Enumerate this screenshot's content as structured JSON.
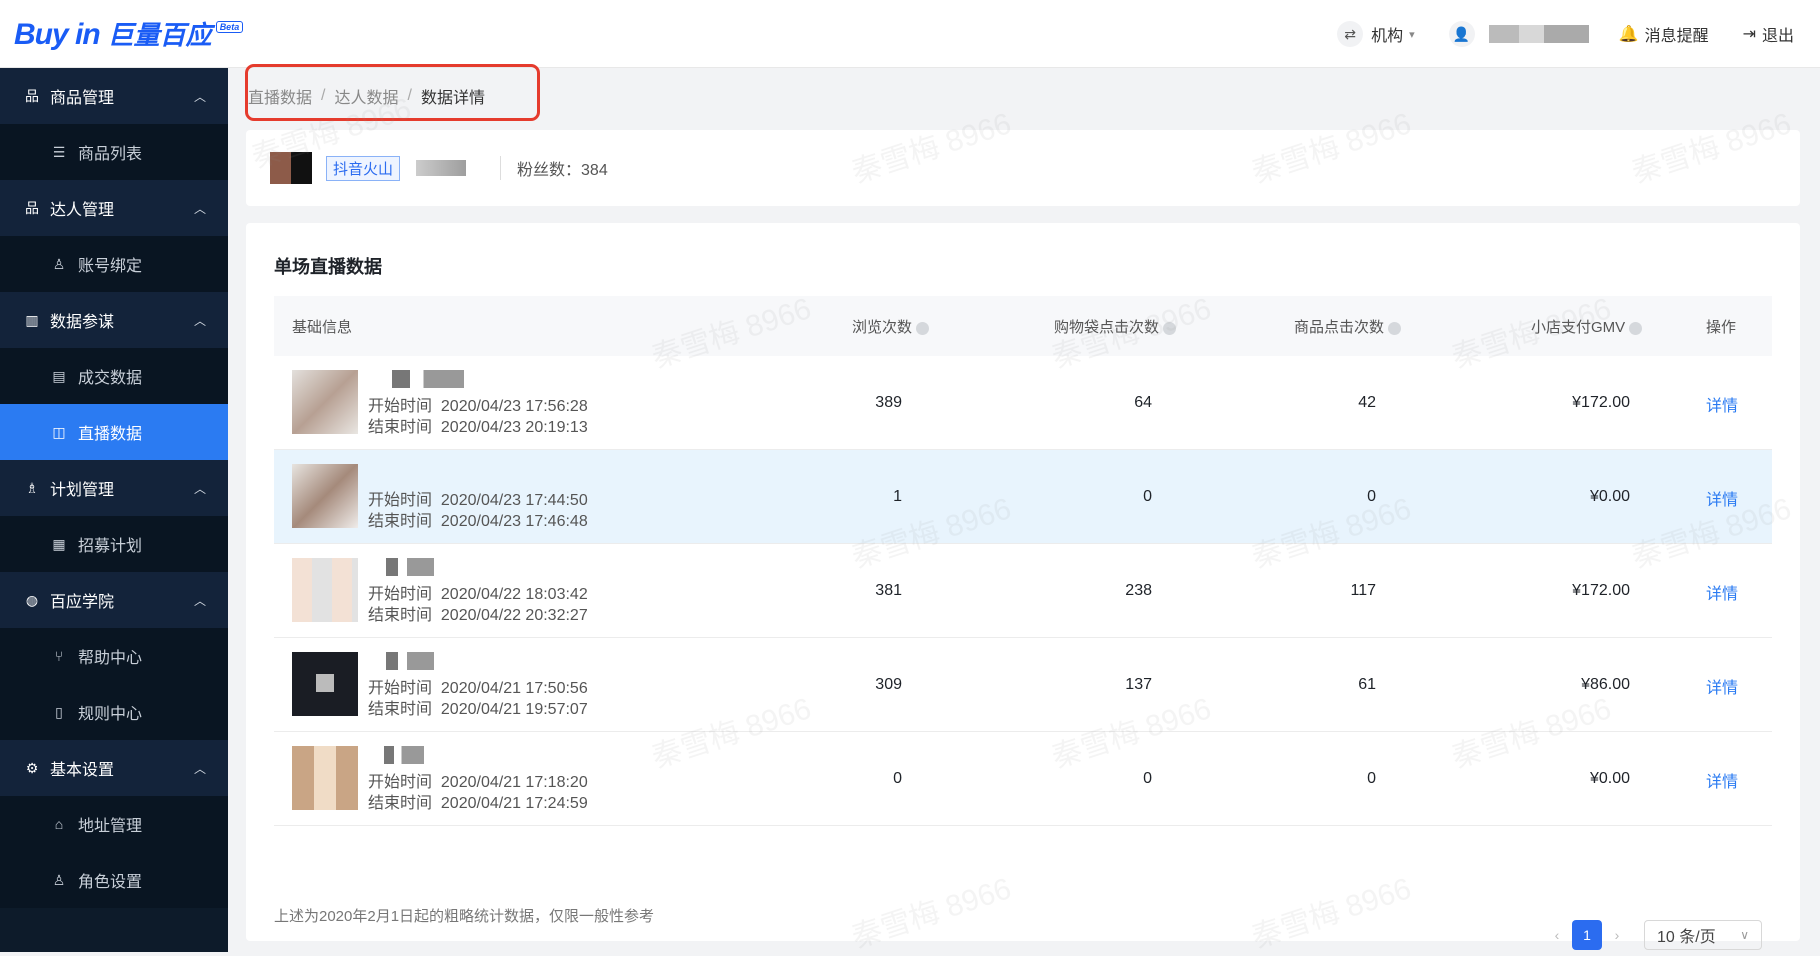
{
  "header": {
    "logo_en": "Buy in",
    "logo_cn": "巨量百应",
    "logo_beta": "Beta",
    "org_label": "机构",
    "notify_label": "消息提醒",
    "logout_label": "退出"
  },
  "sidebar": {
    "groups": [
      {
        "label": "商品管理",
        "items": [
          {
            "label": "商品列表"
          }
        ]
      },
      {
        "label": "达人管理",
        "items": [
          {
            "label": "账号绑定"
          }
        ]
      },
      {
        "label": "数据参谋",
        "items": [
          {
            "label": "成交数据"
          },
          {
            "label": "直播数据"
          }
        ]
      },
      {
        "label": "计划管理",
        "items": [
          {
            "label": "招募计划"
          }
        ]
      },
      {
        "label": "百应学院",
        "items": [
          {
            "label": "帮助中心"
          },
          {
            "label": "规则中心"
          }
        ]
      },
      {
        "label": "基本设置",
        "items": [
          {
            "label": "地址管理"
          },
          {
            "label": "角色设置"
          }
        ]
      }
    ],
    "active_item": "直播数据"
  },
  "breadcrumb": {
    "items": [
      "直播数据",
      "达人数据",
      "数据详情"
    ],
    "separator": "/"
  },
  "profile": {
    "platform_tag": "抖音火山",
    "fans_label": "粉丝数：384"
  },
  "table": {
    "title": "单场直播数据",
    "columns": [
      "基础信息",
      "浏览次数",
      "购物袋点击次数",
      "商品点击次数",
      "小店支付GMV",
      "操作"
    ],
    "start_label": "开始时间",
    "end_label": "结束时间",
    "rows": [
      {
        "start": "2020/04/23 17:56:28",
        "end": "2020/04/23 20:19:13",
        "views": "389",
        "bag_clicks": "64",
        "product_clicks": "42",
        "gmv": "¥172.00",
        "action": "详情"
      },
      {
        "start": "2020/04/23 17:44:50",
        "end": "2020/04/23 17:46:48",
        "views": "1",
        "bag_clicks": "0",
        "product_clicks": "0",
        "gmv": "¥0.00",
        "action": "详情"
      },
      {
        "start": "2020/04/22 18:03:42",
        "end": "2020/04/22 20:32:27",
        "views": "381",
        "bag_clicks": "238",
        "product_clicks": "117",
        "gmv": "¥172.00",
        "action": "详情"
      },
      {
        "start": "2020/04/21 17:50:56",
        "end": "2020/04/21 19:57:07",
        "views": "309",
        "bag_clicks": "137",
        "product_clicks": "61",
        "gmv": "¥86.00",
        "action": "详情"
      },
      {
        "start": "2020/04/21 17:18:20",
        "end": "2020/04/21 17:24:59",
        "views": "0",
        "bag_clicks": "0",
        "product_clicks": "0",
        "gmv": "¥0.00",
        "action": "详情"
      }
    ]
  },
  "pagination": {
    "current": "1",
    "page_size": "10 条/页"
  },
  "footnote": "上述为2020年2月1日起的粗略统计数据，仅限一般性参考",
  "watermark": "秦雪梅 8966",
  "colors": {
    "accent": "#2b7bf2",
    "sidebar_bg": "#0d1b2a",
    "highlight_box": "#e53b2d"
  }
}
